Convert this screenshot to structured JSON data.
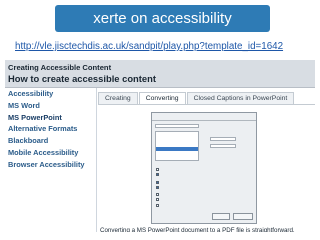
{
  "banner": {
    "title": "xerte on accessibility"
  },
  "url": "http://vle.jisctechdis.ac.uk/sandpit/play.php?template_id=1642",
  "shot": {
    "header": {
      "line1": "Creating Accessible Content",
      "line2": "How to create accessible content"
    },
    "sidebar": {
      "items": [
        {
          "label": "Accessibility"
        },
        {
          "label": "MS Word"
        },
        {
          "label": "MS PowerPoint"
        },
        {
          "label": "Alternative Formats"
        },
        {
          "label": "Blackboard"
        },
        {
          "label": "Mobile Accessibility"
        },
        {
          "label": "Browser Accessibility"
        }
      ]
    },
    "tabs": [
      {
        "label": "Creating"
      },
      {
        "label": "Converting"
      },
      {
        "label": "Closed Captions in PowerPoint"
      }
    ],
    "selected_tab": "Converting",
    "caption": "Converting a MS PowerPoint document to a PDF file is straightforward."
  },
  "colors": {
    "banner": "#2e7bb5",
    "link": "#1e57a8",
    "sidebar_text": "#2b5c8a"
  }
}
